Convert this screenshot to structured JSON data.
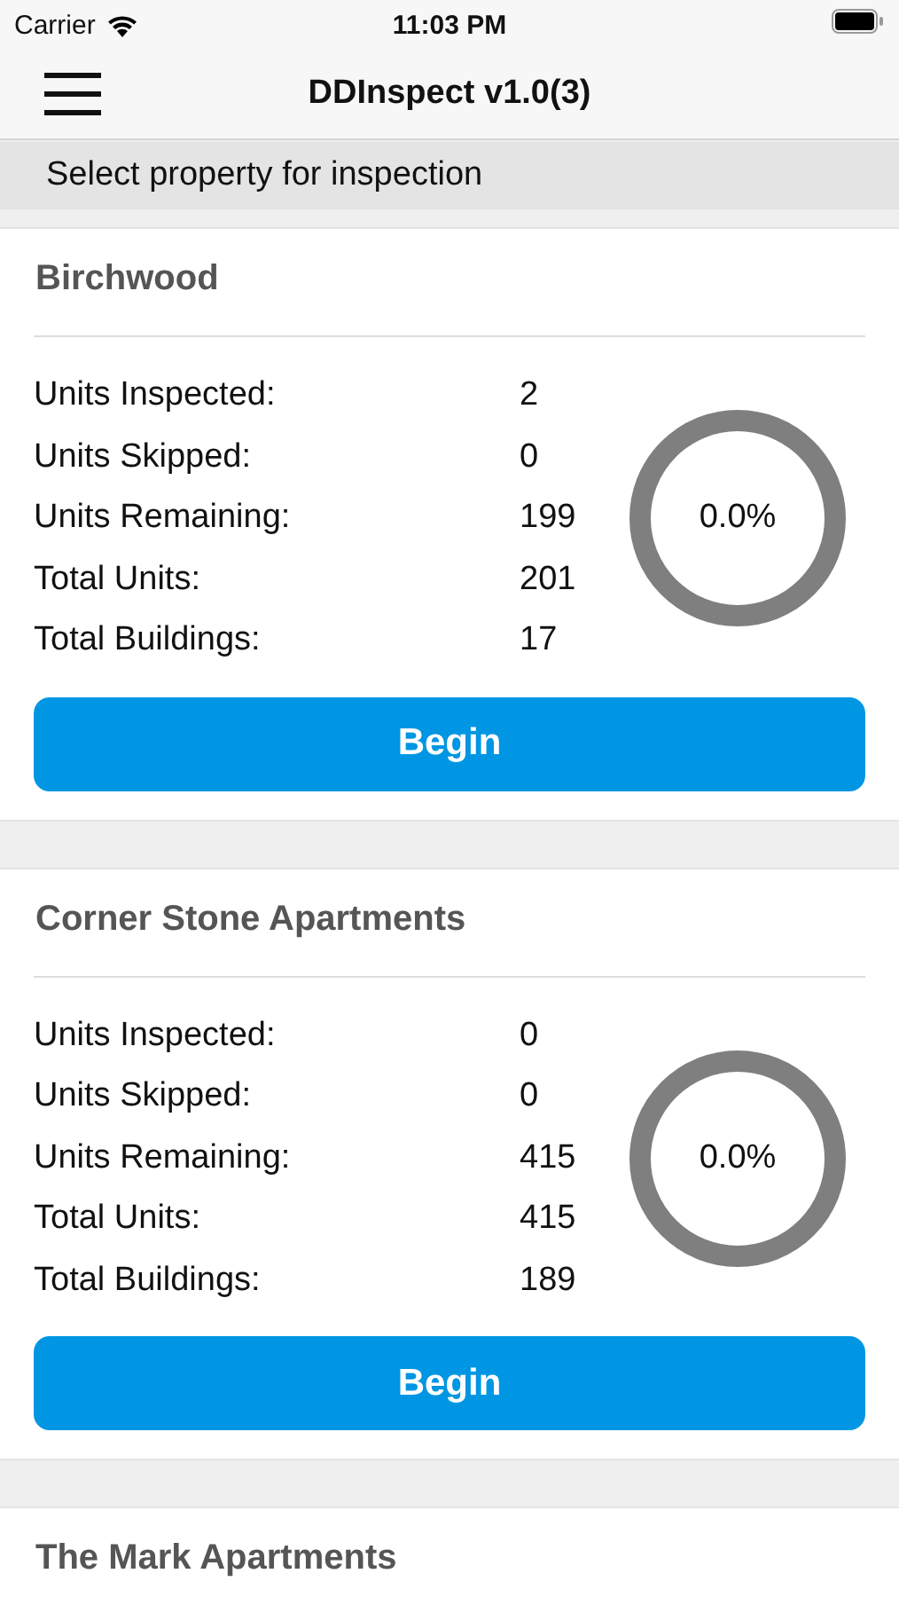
{
  "status_bar": {
    "carrier": "Carrier",
    "time": "11:03 PM"
  },
  "nav_bar": {
    "title": "DDInspect v1.0(3)"
  },
  "section_header": "Select property for inspection",
  "properties": [
    {
      "name": "Birchwood",
      "stats": [
        {
          "label": "Units Inspected:",
          "value": "2"
        },
        {
          "label": "Units Skipped:",
          "value": "0"
        },
        {
          "label": "Units Remaining:",
          "value": "199"
        },
        {
          "label": "Total Units:",
          "value": "201"
        },
        {
          "label": "Total Buildings:",
          "value": "17"
        }
      ],
      "percent": "0.0%",
      "button": "Begin"
    },
    {
      "name": "Corner Stone Apartments",
      "stats": [
        {
          "label": "Units Inspected:",
          "value": "0"
        },
        {
          "label": "Units Skipped:",
          "value": "0"
        },
        {
          "label": "Units Remaining:",
          "value": "415"
        },
        {
          "label": "Total Units:",
          "value": "415"
        },
        {
          "label": "Total Buildings:",
          "value": "189"
        }
      ],
      "percent": "0.0%",
      "button": "Begin"
    },
    {
      "name": "The Mark Apartments"
    }
  ]
}
